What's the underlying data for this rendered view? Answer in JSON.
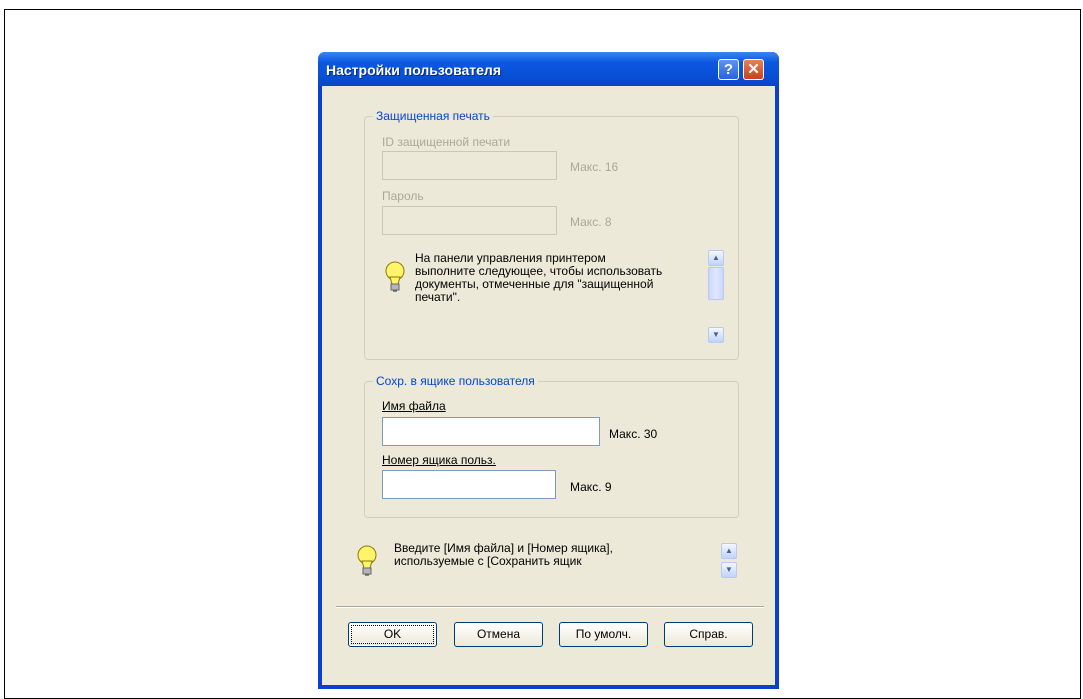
{
  "dialog": {
    "title": "Настройки пользователя",
    "help_label": "?",
    "close_label": "✕"
  },
  "secure_print": {
    "group_title": "Защищенная печать",
    "id_label": "ID защищенной печати",
    "id_value": "",
    "id_max": "Макс. 16",
    "password_label": "Пароль",
    "password_value": "",
    "password_max": "Макс. 8",
    "info_lines": [
      "На панели управления принтером",
      "выполните следующее, чтобы использовать",
      "документы, отмеченные для \"защищенной",
      "печати\"."
    ]
  },
  "user_box": {
    "group_title": "Сохр. в ящике пользователя",
    "filename_label": "Имя файла",
    "filename_value": "",
    "filename_max": "Макс. 30",
    "boxnum_label": "Номер ящика польз.",
    "boxnum_value": "",
    "boxnum_max": "Макс. 9"
  },
  "bottom_info": {
    "lines": [
      "Введите [Имя файла] и [Номер ящика],",
      "используемые с [Сохранить ящик"
    ]
  },
  "buttons": {
    "ok": "OK",
    "cancel": "Отмена",
    "defaults": "По умолч.",
    "help": "Справ."
  },
  "colors": {
    "title_bar": "#0a3fd1",
    "group_title": "#0046d5",
    "dialog_bg": "#ece9d8",
    "disabled_text": "#aca899"
  },
  "icons": {
    "bulb": "lightbulb-icon",
    "help": "help-icon",
    "close": "close-icon",
    "scroll_up": "scroll-up-icon",
    "scroll_down": "scroll-down-icon"
  }
}
